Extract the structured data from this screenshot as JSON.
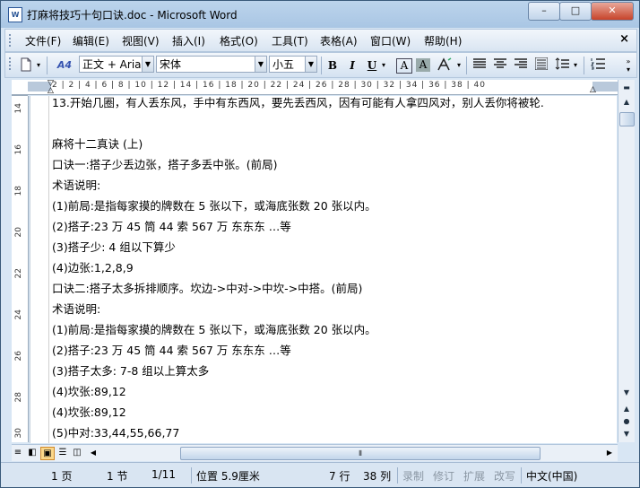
{
  "window": {
    "title": "打麻将技巧十句口诀.doc - Microsoft Word",
    "icon_label": "W",
    "controls": {
      "minimize": "–",
      "maximize": "□",
      "close": "✕"
    }
  },
  "menu": {
    "items": [
      "文件(F)",
      "编辑(E)",
      "视图(V)",
      "插入(I)",
      "格式(O)",
      "工具(T)",
      "表格(A)",
      "窗口(W)",
      "帮助(H)"
    ],
    "close_glyph": "×"
  },
  "toolbar": {
    "style_value": "正文 + Aria",
    "font_value": "宋体",
    "size_value": "小五",
    "bold": "B",
    "italic": "I",
    "underline": "U",
    "char_border": "A",
    "char_shading": "A",
    "style_icon_text": "A4"
  },
  "ruler": {
    "numbers": "2  |  2  |  4  |  6  |  8  | 10 | 12 | 14 | 16 | 18 | 20 | 22 | 24 | 26 | 28 | 30 | 32 | 34 | 36 | 38 | 40",
    "vertical": [
      "14",
      "16",
      "18",
      "20",
      "22",
      "24",
      "26",
      "28",
      "30"
    ]
  },
  "document": {
    "lines": [
      "13.开始几圈，有人丢东风，手中有东西风，要先丢西风，因有可能有人拿四风对，别人丢你将被轮.",
      "",
      "麻将十二真诀 (上)",
      "口诀一:搭子少丢边张，搭子多丢中张。(前局)",
      "术语说明:",
      "(1)前局:是指每家摸的牌数在 5 张以下，或海底张数 20 张以内。",
      "(2)搭子:23 万  45 筒  44 索  567 万  东东东  …等",
      "(3)搭子少: 4  组以下算少",
      "(4)边张:1,2,8,9",
      "口诀二:搭子太多拆排顺序。坎边->中对->中坎->中搭。(前局)",
      "术语说明:",
      "(1)前局:是指每家摸的牌数在 5 张以下，或海底张数 20 张以内。",
      "(2)搭子:23 万  45 筒  44 索  567 万  东东东  …等",
      "(3)搭子太多: 7-8  组以上算太多",
      "(4)坎张:89,12",
      "(4)坎张:89,12",
      "(5)中对:33,44,55,66,77"
    ]
  },
  "status": {
    "page": "1 页",
    "section": "1 节",
    "page_of": "1/11",
    "position": "位置 5.9厘米",
    "line": "7 行",
    "column": "38 列",
    "rec": "录制",
    "trk": "修订",
    "ext": "扩展",
    "ovr": "改写",
    "language": "中文(中国)"
  },
  "colors": {
    "chrome": "#d8e6f4",
    "title_bg": "#bcd4ec",
    "close_red": "#c7432a"
  }
}
